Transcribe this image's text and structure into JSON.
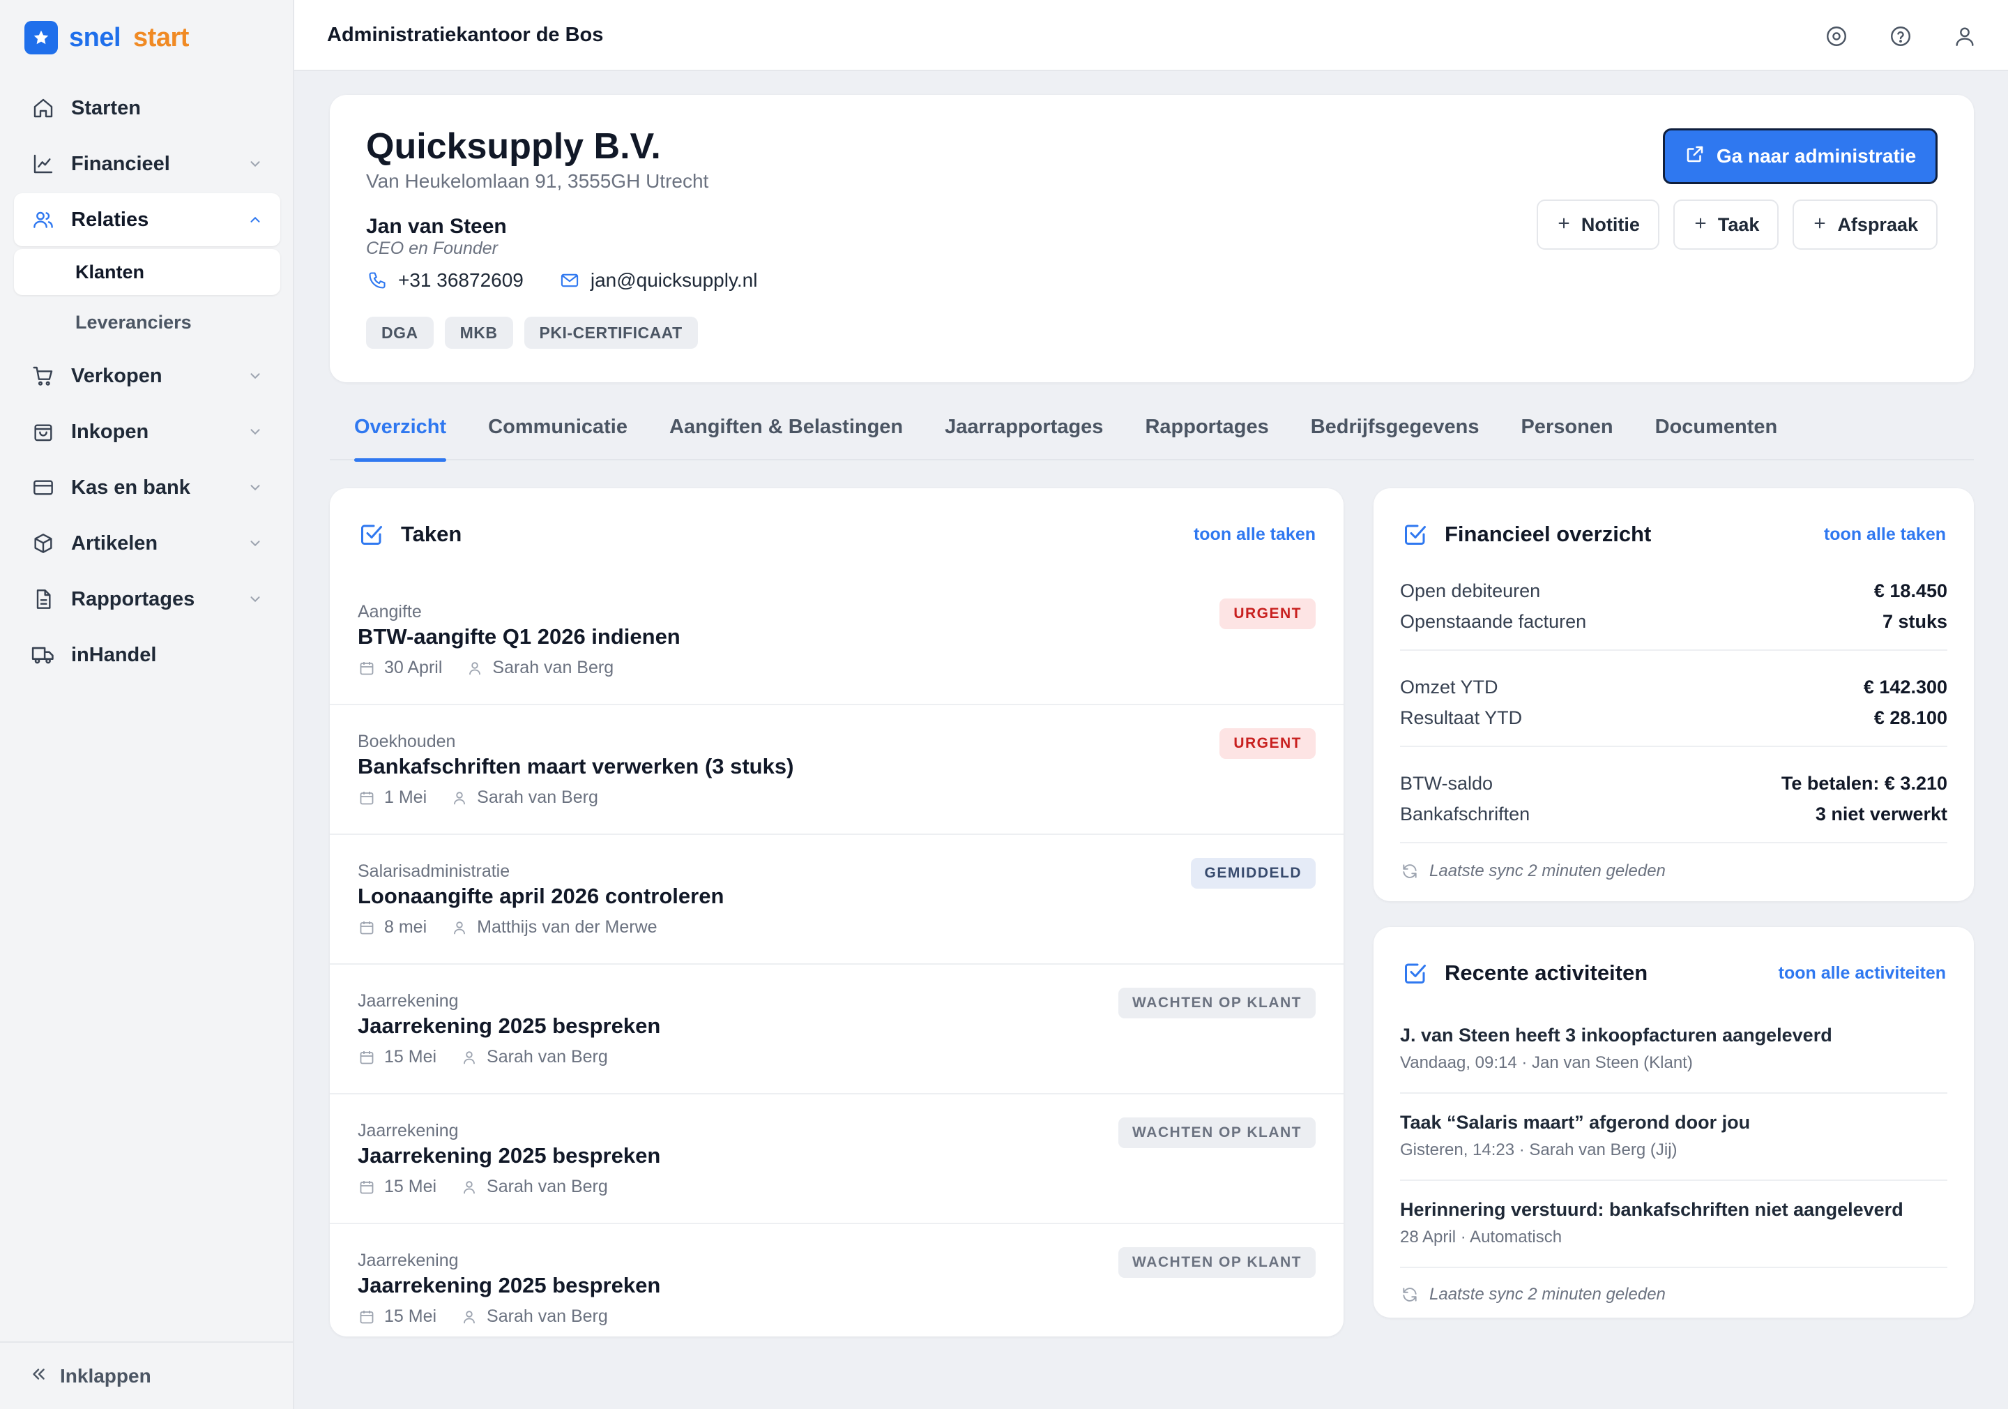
{
  "brand": {
    "part1": "snel",
    "part2": "start",
    "accent": "#1f6feb",
    "accent2": "#f08a24"
  },
  "sidebar": {
    "items": [
      {
        "key": "starten",
        "label": "Starten",
        "icon": "home-icon",
        "chevron": false
      },
      {
        "key": "financieel",
        "label": "Financieel",
        "icon": "chart-icon",
        "chevron": true
      },
      {
        "key": "relaties",
        "label": "Relaties",
        "icon": "users-icon",
        "chevron": true,
        "expanded": true
      },
      {
        "key": "verkopen",
        "label": "Verkopen",
        "icon": "cart-icon",
        "chevron": true
      },
      {
        "key": "inkopen",
        "label": "Inkopen",
        "icon": "bag-icon",
        "chevron": true
      },
      {
        "key": "kas",
        "label": "Kas en bank",
        "icon": "card-icon",
        "chevron": true
      },
      {
        "key": "artikelen",
        "label": "Artikelen",
        "icon": "box-icon",
        "chevron": true
      },
      {
        "key": "rapportages",
        "label": "Rapportages",
        "icon": "report-icon",
        "chevron": true
      },
      {
        "key": "inhandel",
        "label": "inHandel",
        "icon": "truck-icon",
        "chevron": false
      }
    ],
    "sub_items": [
      {
        "label": "Klanten",
        "active": true
      },
      {
        "label": "Leveranciers",
        "active": false
      }
    ],
    "collapse_label": "Inklappen"
  },
  "topbar": {
    "title": "Administratiekantoor de Bos",
    "icons": [
      "settings-icon",
      "help-icon",
      "user-icon"
    ]
  },
  "client": {
    "name": "Quicksupply B.V.",
    "address": "Van Heukelomlaan 91, 3555GH Utrecht",
    "contact_name": "Jan van Steen",
    "contact_role": "CEO en Founder",
    "phone": "+31 36872609",
    "email": "jan@quicksupply.nl",
    "tags": [
      "DGA",
      "MKB",
      "PKI-CERTIFICAAT"
    ],
    "primary_action": "Ga naar administratie",
    "actions": [
      "Notitie",
      "Taak",
      "Afspraak"
    ]
  },
  "tabs": [
    {
      "label": "Overzicht",
      "active": true
    },
    {
      "label": "Communicatie",
      "active": false
    },
    {
      "label": "Aangiften & Belastingen",
      "active": false
    },
    {
      "label": "Jaarrapportages",
      "active": false
    },
    {
      "label": "Rapportages",
      "active": false
    },
    {
      "label": "Bedrijfsgegevens",
      "active": false
    },
    {
      "label": "Personen",
      "active": false
    },
    {
      "label": "Documenten",
      "active": false
    }
  ],
  "tasks": {
    "title": "Taken",
    "link": "toon alle taken",
    "items": [
      {
        "category": "Aangifte",
        "title": "BTW-aangifte Q1 2026 indienen",
        "date": "30 April",
        "assignee": "Sarah van Berg",
        "status": "URGENT",
        "status_type": "urgent"
      },
      {
        "category": "Boekhouden",
        "title": "Bankafschriften maart verwerken (3 stuks)",
        "date": "1 Mei",
        "assignee": "Sarah van Berg",
        "status": "URGENT",
        "status_type": "urgent"
      },
      {
        "category": "Salarisadministratie",
        "title": "Loonaangifte april 2026 controleren",
        "date": "8 mei",
        "assignee": "Matthijs van der Merwe",
        "status": "GEMIDDELD",
        "status_type": "medium"
      },
      {
        "category": "Jaarrekening",
        "title": "Jaarrekening 2025 bespreken",
        "date": "15 Mei",
        "assignee": "Sarah van Berg",
        "status": "WACHTEN OP KLANT",
        "status_type": "waiting"
      },
      {
        "category": "Jaarrekening",
        "title": "Jaarrekening 2025 bespreken",
        "date": "15 Mei",
        "assignee": "Sarah van Berg",
        "status": "WACHTEN OP KLANT",
        "status_type": "waiting"
      },
      {
        "category": "Jaarrekening",
        "title": "Jaarrekening 2025 bespreken",
        "date": "15 Mei",
        "assignee": "Sarah van Berg",
        "status": "WACHTEN OP KLANT",
        "status_type": "waiting"
      }
    ]
  },
  "financial": {
    "title": "Financieel overzicht",
    "link": "toon alle taken",
    "groups": [
      [
        {
          "label": "Open debiteuren",
          "value": "€ 18.450"
        },
        {
          "label": "Openstaande facturen",
          "value": "7 stuks"
        }
      ],
      [
        {
          "label": "Omzet YTD",
          "value": "€ 142.300"
        },
        {
          "label": "Resultaat YTD",
          "value": "€ 28.100"
        }
      ],
      [
        {
          "label": "BTW-saldo",
          "value": "Te betalen: € 3.210"
        },
        {
          "label": "Bankafschriften",
          "value": "3 niet verwerkt"
        }
      ]
    ],
    "sync": "Laatste sync 2 minuten geleden"
  },
  "activity": {
    "title": "Recente activiteiten",
    "link": "toon alle activiteiten",
    "items": [
      {
        "title": "J. van Steen heeft 3 inkoopfacturen aangeleverd",
        "sub": "Vandaag, 09:14 · Jan van Steen (Klant)"
      },
      {
        "title": "Taak “Salaris maart” afgerond door jou",
        "sub": "Gisteren, 14:23 · Sarah van Berg (Jij)"
      },
      {
        "title": "Herinnering verstuurd: bankafschriften niet aangeleverd",
        "sub": "28 April · Automatisch"
      }
    ],
    "sync": "Laatste sync 2 minuten geleden"
  }
}
